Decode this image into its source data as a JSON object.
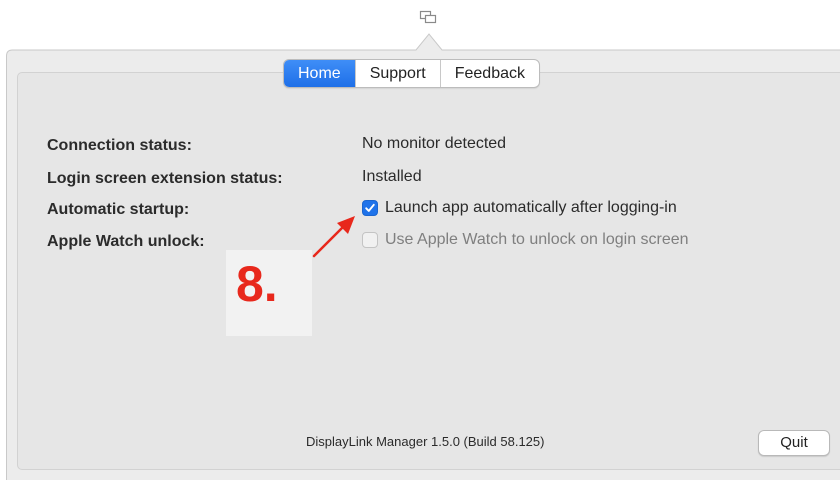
{
  "menubar": {
    "icon": "displaylink-menubar-icon"
  },
  "tabs": [
    {
      "label": "Home",
      "active": true
    },
    {
      "label": "Support",
      "active": false
    },
    {
      "label": "Feedback",
      "active": false
    }
  ],
  "status": {
    "connection_label": "Connection status:",
    "connection_value": "No monitor detected",
    "login_ext_label": "Login screen extension status:",
    "login_ext_value": "Installed",
    "auto_startup_label": "Automatic startup:",
    "auto_startup_option": "Launch app automatically after logging-in",
    "auto_startup_checked": true,
    "watch_unlock_label": "Apple Watch unlock:",
    "watch_unlock_option": "Use Apple Watch to unlock on login screen",
    "watch_unlock_checked": false
  },
  "annotation": {
    "step_label": "8.",
    "color": "#e8281c"
  },
  "footer": {
    "version": "DisplayLink Manager 1.5.0 (Build 58.125)",
    "quit_label": "Quit"
  },
  "colors": {
    "accent": "#1f73ea",
    "panel": "#e6e6e6"
  }
}
